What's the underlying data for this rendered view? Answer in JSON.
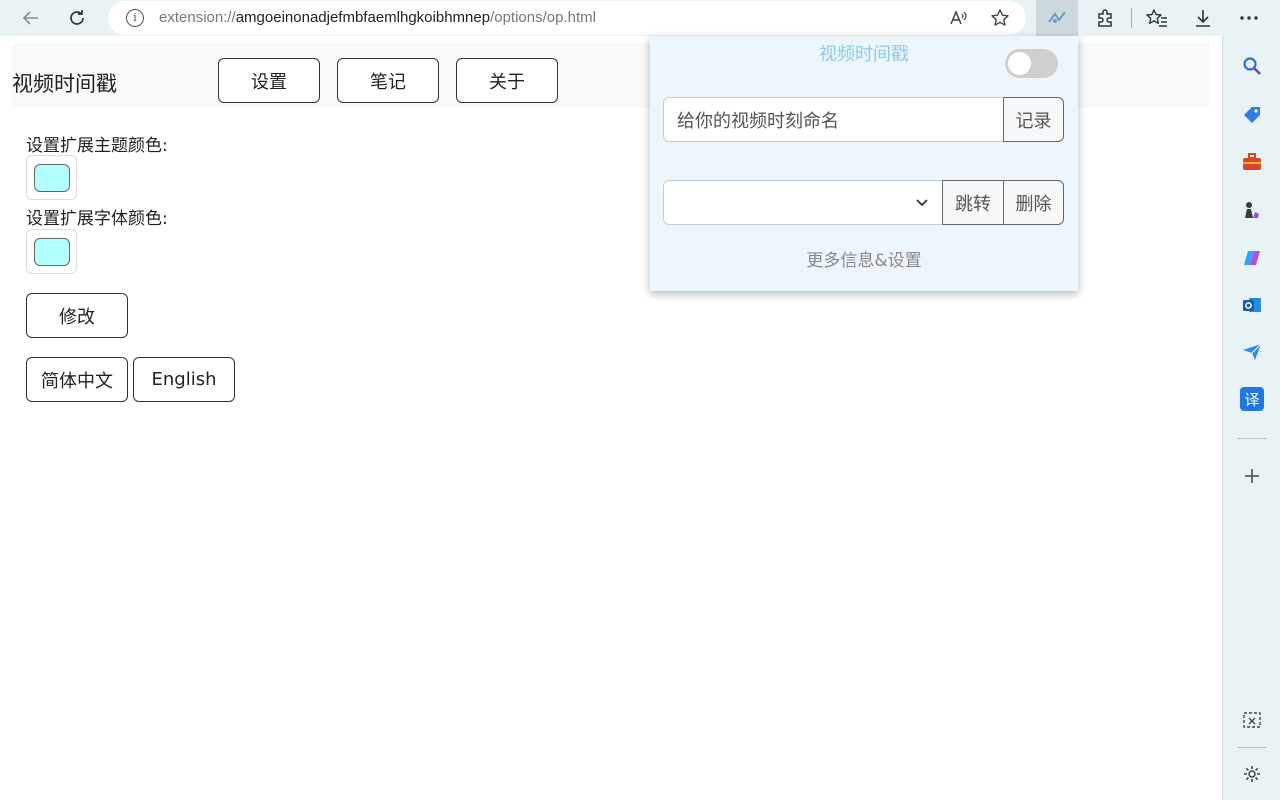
{
  "browser": {
    "url_scheme": "extension://",
    "url_host": "amgoeinonadjefmbfaemlhgkoibhmnep",
    "url_path": "/options/op.html",
    "info_glyph": "i",
    "icons": [
      "back-icon",
      "refresh-icon",
      "info-icon",
      "read-aloud-icon",
      "favorite-star-icon",
      "extension-video-icon",
      "extensions-puzzle-icon",
      "favorites-collection-icon",
      "downloads-icon",
      "more-menu-icon"
    ]
  },
  "page": {
    "brand": "视频时间戳",
    "nav": {
      "settings": "设置",
      "notes": "笔记",
      "about": "关于"
    },
    "theme_color_label": "设置扩展主题颜色:",
    "font_color_label": "设置扩展字体颜色:",
    "theme_color": "#b3ffff",
    "font_color": "#b3ffff",
    "modify_button": "修改",
    "lang_zh": "简体中文",
    "lang_en": "English"
  },
  "popup": {
    "title": "视频时间戳",
    "toggle_on": false,
    "name_placeholder": "给你的视频时刻命名",
    "record_button": "记录",
    "selected_timestamp": "",
    "jump_button": "跳转",
    "delete_button": "删除",
    "more_link": "更多信息&设置"
  },
  "sidebar": {
    "icons": [
      "search-icon",
      "shopping-tag-icon",
      "tools-briefcase-icon",
      "games-chess-icon",
      "copilot-icon",
      "outlook-icon",
      "send-paper-plane-icon",
      "translate-icon",
      "add-icon",
      "screenshot-icon",
      "settings-gear-icon"
    ],
    "translate_glyph": "译"
  },
  "colors": {
    "accent": "#8ec9ee",
    "toolbar_bg": "#e9f3f6",
    "popup_bg": "#eef6fd"
  }
}
